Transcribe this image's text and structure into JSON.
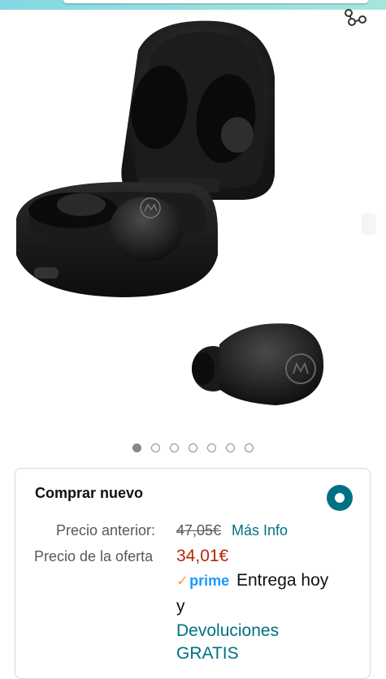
{
  "header": {
    "share_icon": "share-icon"
  },
  "gallery": {
    "image_count": 7,
    "active_index": 0
  },
  "offer": {
    "title": "Comprar nuevo",
    "selected": true,
    "previous_price_label": "Precio anterior:",
    "previous_price": "47,05€",
    "more_info_link": "Más Info",
    "deal_price_label": "Precio de la oferta",
    "deal_price": "34,01€",
    "prime_check": "✓",
    "prime_label": "prime",
    "delivery_text": "Entrega hoy",
    "delivery_conjunction": "y",
    "returns_line1": "Devoluciones",
    "returns_line2": "GRATIS"
  },
  "colors": {
    "accent_teal": "#007185",
    "price_red": "#b12704",
    "prime_blue": "#1a98ff",
    "prime_check_orange": "#f3a847"
  }
}
